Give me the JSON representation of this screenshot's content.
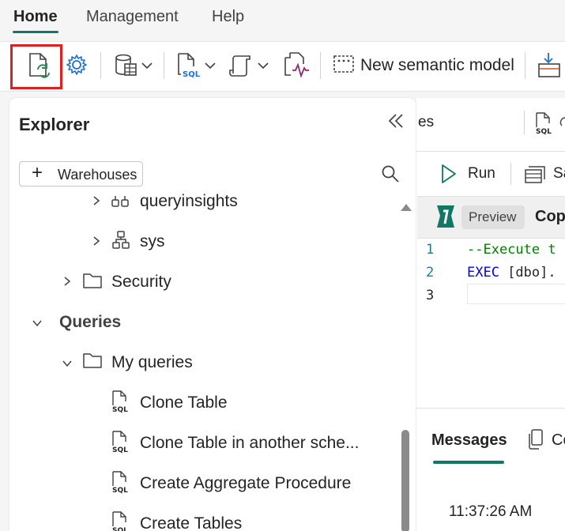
{
  "menu": {
    "tabs": [
      "Home",
      "Management",
      "Help"
    ],
    "active": "Home"
  },
  "toolbar": {
    "new_semantic_model": "New semantic model"
  },
  "explorer": {
    "title": "Explorer",
    "warehouses_button": "Warehouses",
    "tree": {
      "queryinsights": "queryinsights",
      "sys": "sys",
      "security": "Security",
      "queries": "Queries",
      "my_queries": "My queries",
      "items": [
        "Clone Table",
        "Clone Table in another sche...",
        "Create Aggregate Procedure",
        "Create Tables"
      ]
    }
  },
  "editor": {
    "tab_partial": "es",
    "run": "Run",
    "save_partial": "Sa",
    "preview_badge": "Preview",
    "copilot_partial": "Cop",
    "lines": [
      {
        "num": "1",
        "text": "--Execute t"
      },
      {
        "num": "2",
        "kw": "EXEC",
        "text": " [dbo]."
      },
      {
        "num": "3",
        "text": ""
      }
    ],
    "messages_tab": "Messages",
    "second_tab_partial": "Co",
    "timestamp": "11:37:26 AM"
  },
  "colors": {
    "accent": "#117865",
    "highlight": "#e02020",
    "keyword": "#0000ff",
    "comment": "#008000"
  }
}
